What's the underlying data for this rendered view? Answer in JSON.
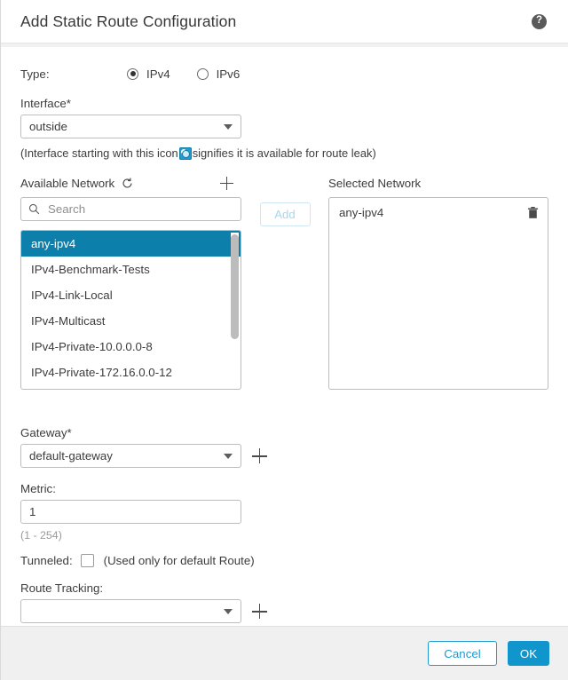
{
  "header": {
    "title": "Add Static Route Configuration",
    "help_icon": "help-circle-icon",
    "help_glyph": "?"
  },
  "type_field": {
    "label": "Type:",
    "options": [
      {
        "label": "IPv4",
        "selected": true
      },
      {
        "label": "IPv6",
        "selected": false
      }
    ]
  },
  "interface_field": {
    "label": "Interface*",
    "value": "outside",
    "hint_before": "(Interface starting with this icon ",
    "hint_icon": "route-leak-icon",
    "hint_after": "signifies it is available for route leak)"
  },
  "available_network": {
    "title": "Available Network",
    "refresh_icon": "refresh-icon",
    "add_new_icon": "plus-icon",
    "search_placeholder": "Search",
    "search_value": "",
    "items": [
      "any-ipv4",
      "IPv4-Benchmark-Tests",
      "IPv4-Link-Local",
      "IPv4-Multicast",
      "IPv4-Private-10.0.0.0-8",
      "IPv4-Private-172.16.0.0-12"
    ],
    "selected_item": "any-ipv4"
  },
  "add_button": {
    "label": "Add",
    "disabled": true
  },
  "selected_network": {
    "title": "Selected Network",
    "items": [
      {
        "label": "any-ipv4",
        "delete_icon": "trash-icon"
      }
    ]
  },
  "gateway_field": {
    "label": "Gateway*",
    "value": "default-gateway",
    "add_icon": "plus-icon"
  },
  "metric_field": {
    "label": "Metric:",
    "value": "1",
    "range_note": "(1 - 254)"
  },
  "tunneled_field": {
    "label": "Tunneled:",
    "checked": false,
    "note": "(Used only for default Route)"
  },
  "route_tracking_field": {
    "label": "Route Tracking:",
    "value": "",
    "add_icon": "plus-icon"
  },
  "footer": {
    "cancel_label": "Cancel",
    "ok_label": "OK"
  },
  "colors": {
    "accent": "#1095cc",
    "selected_row": "#0d7fab",
    "footer_bg": "#f0f0f0",
    "border": "#bdbdbd"
  }
}
